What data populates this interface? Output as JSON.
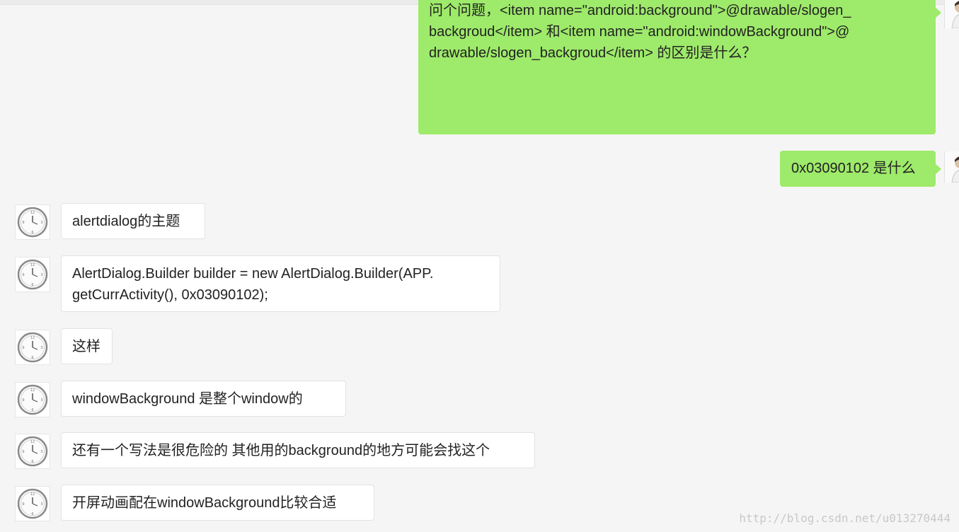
{
  "messages": [
    {
      "direction": "outgoing",
      "lines": [
        "问个问题，<item name=\"android:background\">@drawable/slogen_",
        "backgroud</item> 和<item name=\"android:windowBackground\">@",
        "drawable/slogen_backgroud</item>  的区别是什么？"
      ]
    },
    {
      "direction": "outgoing",
      "lines": [
        "0x03090102 是什么"
      ]
    },
    {
      "direction": "incoming",
      "lines": [
        "alertdialog的主题"
      ]
    },
    {
      "direction": "incoming",
      "lines": [
        "AlertDialog.Builder builder = new AlertDialog.Builder(APP.",
        "getCurrActivity(), 0x03090102);"
      ]
    },
    {
      "direction": "incoming",
      "lines": [
        "这样"
      ]
    },
    {
      "direction": "incoming",
      "lines": [
        "windowBackground 是整个window的"
      ]
    },
    {
      "direction": "incoming",
      "lines": [
        "还有一个写法是很危险的 其他用的background的地方可能会找这个"
      ]
    },
    {
      "direction": "incoming",
      "lines": [
        "开屏动画配在windowBackground比较合适"
      ]
    }
  ],
  "avatars": {
    "self_icon": "user-photo-avatar",
    "peer_icon": "clock-face-avatar"
  },
  "watermark": "http://blog.csdn.net/u013270444",
  "colors": {
    "background": "#f5f5f5",
    "outgoing_bubble": "#9eea6a",
    "incoming_bubble": "#ffffff",
    "text": "#222222"
  }
}
